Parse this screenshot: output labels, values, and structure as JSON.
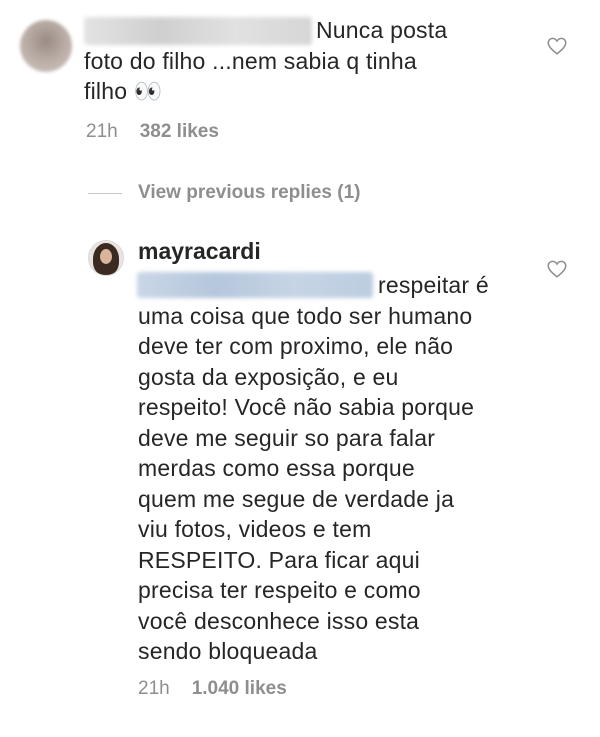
{
  "comment1": {
    "text_line1": "Nunca posta",
    "text_line2": "foto do filho ...nem sabia q tinha",
    "text_line3": "filho 👀",
    "time": "21h",
    "likes": "382 likes"
  },
  "view_replies": "View previous replies (1)",
  "reply": {
    "username": "mayracardi",
    "lines": [
      "respeitar é",
      "uma coisa que todo ser humano",
      "deve ter com proximo, ele não",
      "gosta da exposição, e eu",
      "respeito! Você não sabia porque",
      "deve me seguir so para falar",
      "merdas como essa porque",
      "quem me segue de verdade ja",
      "viu fotos, videos e  tem",
      "RESPEITO. Para ficar aqui",
      "precisa ter respeito e como",
      "você desconhece isso  esta",
      "sendo bloqueada"
    ],
    "time": "21h",
    "likes": "1.040 likes"
  },
  "icons": {
    "heart": "heart-outline-icon"
  },
  "colors": {
    "text": "#262626",
    "secondary": "#8e8e8e"
  }
}
